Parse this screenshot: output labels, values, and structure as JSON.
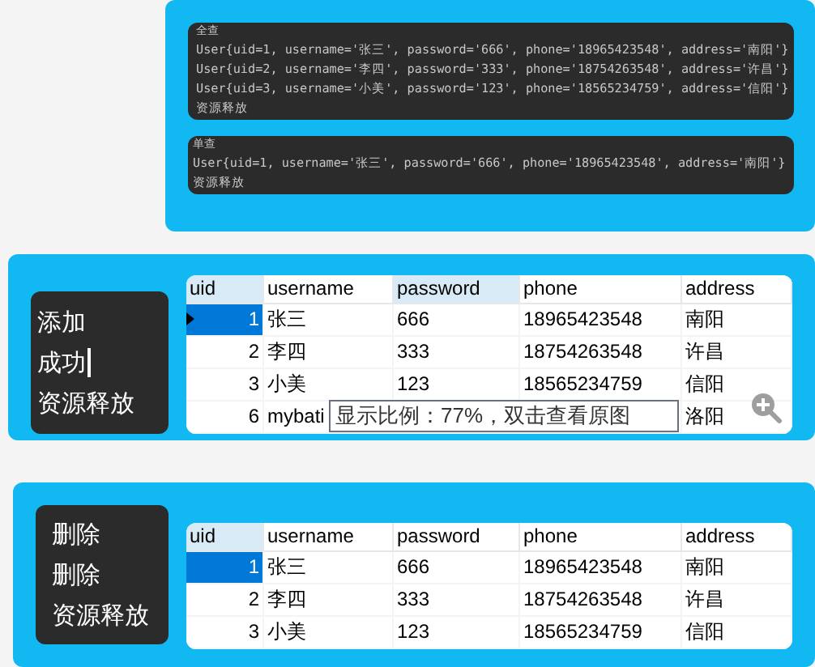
{
  "console_panel": {
    "blocks": [
      {
        "title": "全查",
        "lines": [
          "User{uid=1, username='张三', password='666', phone='18965423548', address='南阳'}",
          "User{uid=2, username='李四', password='333', phone='18754263548', address='许昌'}",
          "User{uid=3, username='小美', password='123', phone='18565234759', address='信阳'}",
          "资源释放"
        ]
      },
      {
        "title": "单查",
        "lines": [
          "User{uid=1, username='张三', password='666', phone='18965423548', address='南阳'}",
          "资源释放"
        ]
      }
    ]
  },
  "sections": [
    {
      "messages": [
        {
          "text": "添加",
          "caret": false
        },
        {
          "text": "成功",
          "caret": true
        },
        {
          "text": "资源释放",
          "caret": false
        }
      ],
      "table": {
        "row_marker": true,
        "columns": [
          {
            "label": "uid",
            "highlighted": true
          },
          {
            "label": "username",
            "highlighted": false
          },
          {
            "label": "password",
            "highlighted": true
          },
          {
            "label": "phone",
            "highlighted": false
          },
          {
            "label": "address",
            "highlighted": false
          }
        ],
        "rows": [
          {
            "current": true,
            "cells": [
              "1",
              "张三",
              "666",
              "18965423548",
              "南阳"
            ]
          },
          {
            "current": false,
            "cells": [
              "2",
              "李四",
              "333",
              "18754263548",
              "许昌"
            ]
          },
          {
            "current": false,
            "cells": [
              "3",
              "小美",
              "123",
              "18565234759",
              "信阳"
            ]
          },
          {
            "current": false,
            "cells": [
              "6",
              "mybati",
              null,
              null,
              "洛阳"
            ]
          }
        ]
      },
      "tooltip": "显示比例：77%，双击查看原图",
      "zoom_button": true
    },
    {
      "messages": [
        {
          "text": "删除",
          "caret": false
        },
        {
          "text": "删除",
          "caret": false
        },
        {
          "text": "资源释放",
          "caret": false
        }
      ],
      "table": {
        "row_marker": false,
        "columns": [
          {
            "label": "uid",
            "highlighted": true
          },
          {
            "label": "username",
            "highlighted": false
          },
          {
            "label": "password",
            "highlighted": false
          },
          {
            "label": "phone",
            "highlighted": false
          },
          {
            "label": "address",
            "highlighted": false
          }
        ],
        "rows": [
          {
            "current": true,
            "cells": [
              "1",
              "张三",
              "666",
              "18965423548",
              "南阳"
            ]
          },
          {
            "current": false,
            "cells": [
              "2",
              "李四",
              "333",
              "18754263548",
              "许昌"
            ]
          },
          {
            "current": false,
            "cells": [
              "3",
              "小美",
              "123",
              "18565234759",
              "信阳"
            ]
          }
        ]
      },
      "zoom_button": false
    }
  ]
}
